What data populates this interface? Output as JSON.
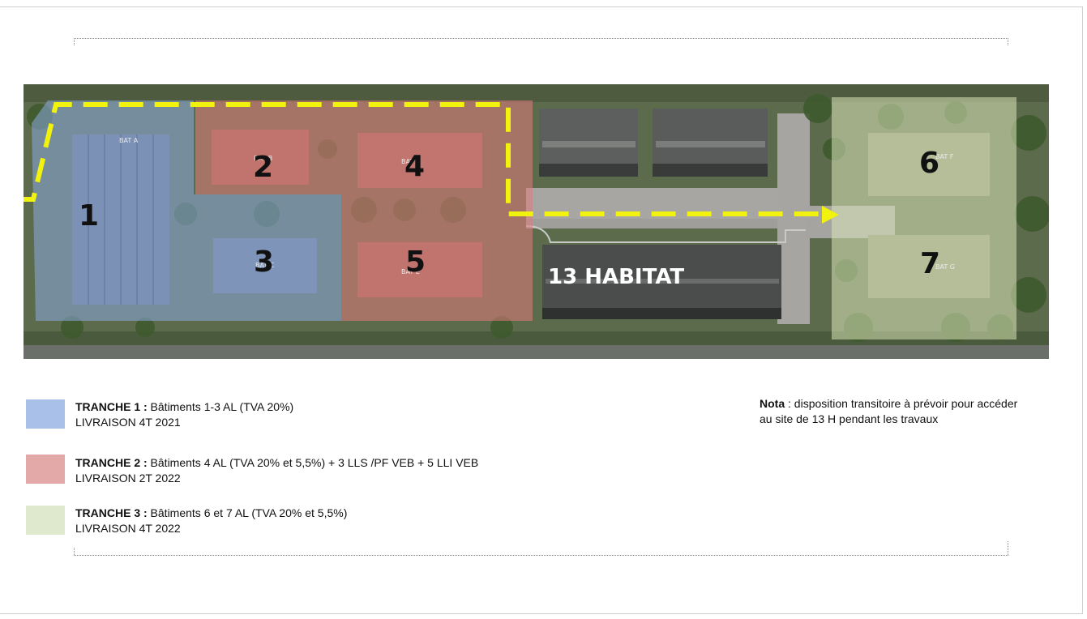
{
  "map": {
    "building_numbers": [
      "1",
      "2",
      "3",
      "4",
      "5",
      "6",
      "7"
    ],
    "habitat_label": "13 HABITAT",
    "building_tags": [
      "BAT A",
      "BAT B",
      "BAT C",
      "BAT D",
      "BAT E",
      "BAT F",
      "BAT G"
    ]
  },
  "legend": [
    {
      "color": "#a9c1e8",
      "title": "TRANCHE 1 :",
      "text": " Bâtiments 1-3 AL (TVA 20%)",
      "delivery": "LIVRAISON 4T 2021"
    },
    {
      "color": "#e3a8a8",
      "title": "TRANCHE 2 :",
      "text": " Bâtiments 4 AL (TVA 20% et 5,5%)  + 3 LLS /PF VEB + 5 LLI VEB",
      "delivery": "LIVRAISON 2T 2022"
    },
    {
      "color": "#dfe9cd",
      "title": "TRANCHE 3 :",
      "text": " Bâtiments 6 et 7 AL (TVA 20% et 5,5%)",
      "delivery": "LIVRAISON 4T 2022"
    }
  ],
  "nota": {
    "label": "Nota",
    "text": " : disposition transitoire à prévoir pour accéder au site de 13 H pendant les travaux"
  }
}
